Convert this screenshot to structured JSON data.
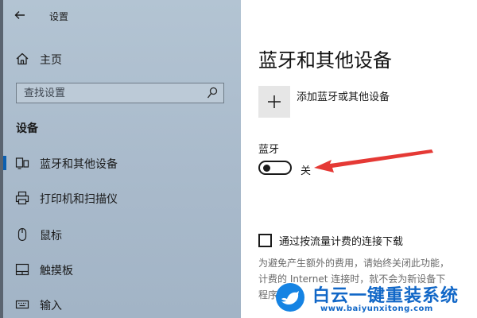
{
  "window": {
    "title": "设置"
  },
  "sidebar": {
    "home_label": "主页",
    "search": {
      "placeholder": "查找设置",
      "value": ""
    },
    "section_title": "设备",
    "items": [
      {
        "label": "蓝牙和其他设备",
        "icon": "bluetooth-devices-icon",
        "selected": true
      },
      {
        "label": "打印机和扫描仪",
        "icon": "printer-icon",
        "selected": false
      },
      {
        "label": "鼠标",
        "icon": "mouse-icon",
        "selected": false
      },
      {
        "label": "触摸板",
        "icon": "touchpad-icon",
        "selected": false
      },
      {
        "label": "输入",
        "icon": "keyboard-icon",
        "selected": false
      }
    ]
  },
  "main": {
    "title": "蓝牙和其他设备",
    "add_device_label": "添加蓝牙或其他设备",
    "bluetooth_label": "蓝牙",
    "bluetooth_state": "关",
    "bluetooth_on": false,
    "metered_label": "通过按流量计费的连接下载",
    "metered_checked": false,
    "metered_desc": [
      "为避免产生额外的费用，请始终关闭此功能，",
      "计费的 Internet 连接时，就不会为新设备下",
      "程序"
    ]
  },
  "watermark": {
    "text": "白云一键重装系统",
    "url": "www.baiyunxitong.com"
  },
  "colors": {
    "sidebar_bg": "#aebfd0",
    "accent": "#0b5fb0",
    "annotation_arrow": "#e53935",
    "watermark": "#1167c7"
  }
}
